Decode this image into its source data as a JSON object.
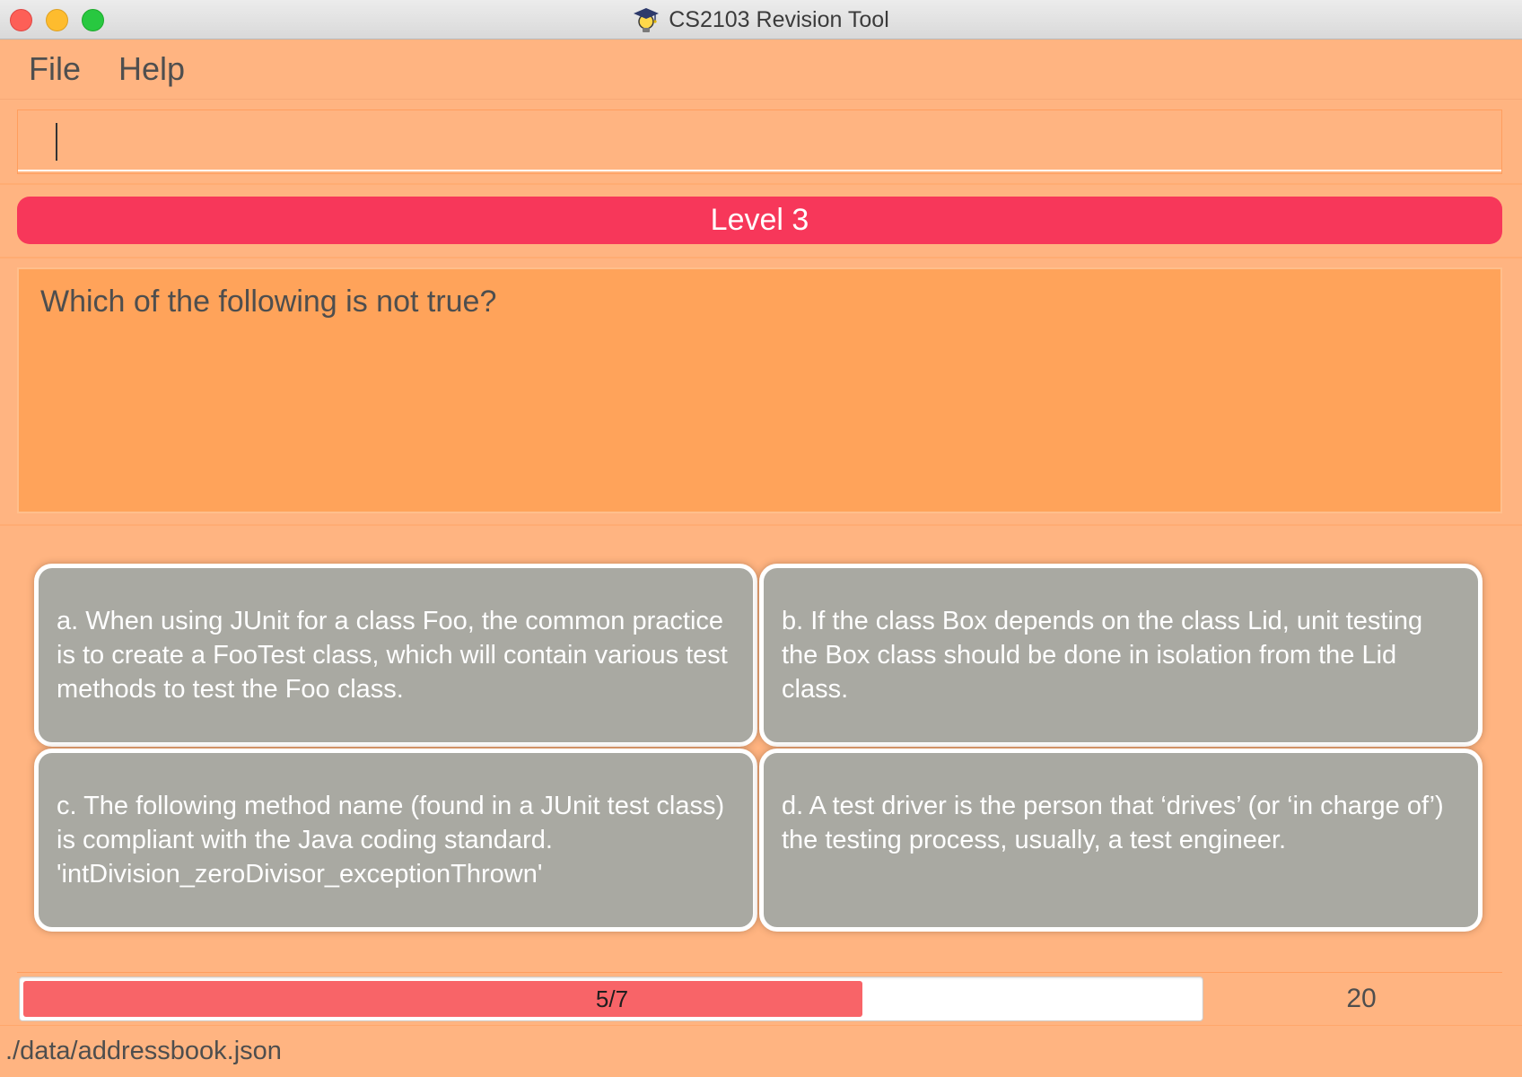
{
  "window": {
    "title": "CS2103 Revision Tool"
  },
  "menu": {
    "items": [
      "File",
      "Help"
    ]
  },
  "command": {
    "value": "",
    "placeholder": ""
  },
  "level": {
    "label": "Level 3",
    "color": "#f7375a"
  },
  "question": {
    "text": "Which of the following is not true?"
  },
  "answers": [
    {
      "text": "a. When using JUnit for a class Foo, the common practice is to create a FooTest class, which will contain various test methods to test the Foo class."
    },
    {
      "text": "b. If the class Box depends on the class Lid, unit testing the Box class should be done in isolation from the Lid class."
    },
    {
      "text": "c. The following method name (found in a JUnit test class) is compliant with the Java coding standard. 'intDivision_zeroDivisor_exceptionThrown'"
    },
    {
      "text": "d. A test driver is the person that ‘drives’ (or ‘in charge of’) the testing process, usually, a test engineer."
    }
  ],
  "progress": {
    "label": "5/7",
    "fraction": 0.714,
    "fill_color": "#f86468"
  },
  "score": {
    "value": "20"
  },
  "status": {
    "path": "./data/addressbook.json"
  },
  "colors": {
    "background": "#ffb481",
    "question_panel": "#ffa35a",
    "answer_card": "#a9a9a2"
  },
  "icons": {
    "app": "graduation-cap-lightbulb-icon"
  }
}
